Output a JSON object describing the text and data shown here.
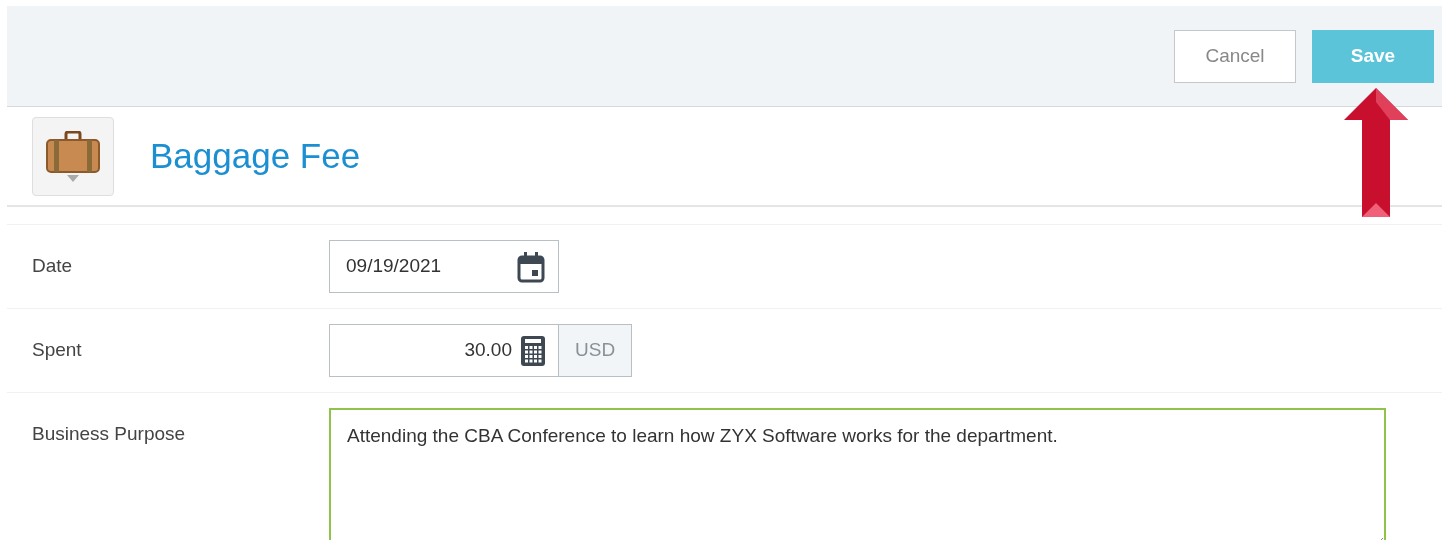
{
  "toolbar": {
    "buttons": [
      {
        "label": "Cancel",
        "kind": "secondary"
      },
      {
        "label": "Save",
        "kind": "primary"
      }
    ]
  },
  "expense": {
    "title": "Baggage Fee"
  },
  "fields": [
    {
      "label": "Date",
      "kind": "date",
      "value": "09/19/2021"
    },
    {
      "label": "Spent",
      "kind": "amount",
      "value": "30.00",
      "currency": "USD"
    },
    {
      "label": "Business Purpose",
      "kind": "textarea",
      "value": "Attending the CBA Conference to learn how ZYX Software works for the department."
    }
  ]
}
